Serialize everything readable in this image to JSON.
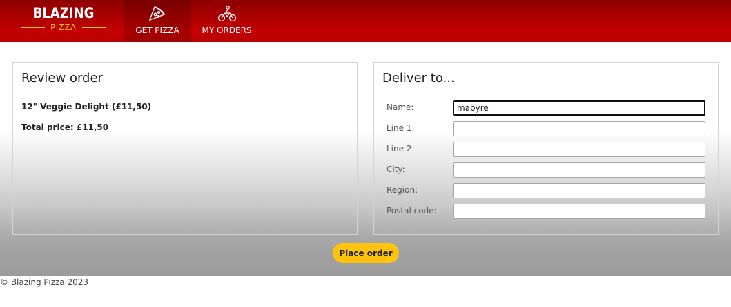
{
  "brand": {
    "title": "BLAZING",
    "subtitle": "PIZZA"
  },
  "nav": [
    {
      "label": "GET PIZZA",
      "icon": "pizza-slice-icon",
      "active": true
    },
    {
      "label": "MY ORDERS",
      "icon": "motorbike-icon",
      "active": false
    }
  ],
  "review": {
    "heading": "Review order",
    "items": [
      "12\" Veggie Delight (£11,50)"
    ],
    "total": "Total price: £11,50"
  },
  "delivery": {
    "heading": "Deliver to...",
    "fields": [
      {
        "label": "Name:",
        "value": "mabyre"
      },
      {
        "label": "Line 1:",
        "value": ""
      },
      {
        "label": "Line 2:",
        "value": ""
      },
      {
        "label": "City:",
        "value": ""
      },
      {
        "label": "Region:",
        "value": ""
      },
      {
        "label": "Postal code:",
        "value": ""
      }
    ]
  },
  "actions": {
    "place_order": "Place order"
  },
  "footer": {
    "copyright": "© Blazing Pizza 2023"
  },
  "colors": {
    "brand_red": "#c40000",
    "accent_yellow": "#ffc20e"
  }
}
